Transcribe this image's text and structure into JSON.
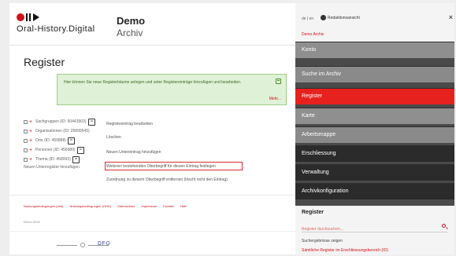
{
  "brand": {
    "name": "Oral-History.Digital"
  },
  "header": {
    "title": "Demo",
    "subtitle": "Archiv"
  },
  "page": {
    "title": "Register"
  },
  "info_box": {
    "text": "Hier können Sie neue Registerbäume anlegen und unter Registereinträge hinzufügen und bearbeiten.",
    "more": "Mehr..."
  },
  "tree": {
    "items": [
      {
        "label": "Sachgruppen (ID: 60443903)"
      },
      {
        "label": "Organisationen (ID: 25899545)"
      },
      {
        "label": "Orte (ID: 459888)"
      },
      {
        "label": "Personen (ID: 456989)"
      },
      {
        "label": "Thema (ID: 458993)"
      }
    ],
    "new_root": "Neuen Unterregister hinzufügen"
  },
  "context_menu": {
    "items": [
      "Registereintrag bearbeiten",
      "Löschen",
      "Neuen Untereintrag hinzufügen",
      "Weiteren bestehenden Oberbegriff für diesen Eintrag festlegen",
      "Zuordnung zu diesem Oberbegriff entfernen (löscht nicht den Eintrag)"
    ]
  },
  "footer": {
    "links": [
      "Nutzungsbedingungen (ohd)",
      "Nutzungsbedingungen (OHD)",
      "Datenschutz",
      "Impressum",
      "Kontakt",
      "Hilfe"
    ],
    "version": "Demo 2025"
  },
  "panel": {
    "lang": "de | en",
    "toggle_label": "Redaktionsansicht",
    "subtitle": "Demo Archiv",
    "nav": [
      {
        "label": "Konto",
        "state": "normal"
      },
      {
        "label": "Suche im Archiv",
        "state": "normal"
      },
      {
        "label": "Register",
        "state": "active"
      },
      {
        "label": "Karte",
        "state": "normal"
      },
      {
        "label": "Arbeitsmappe",
        "state": "normal"
      },
      {
        "label": "Erschliessung",
        "state": "dark"
      },
      {
        "label": "Verwaltung",
        "state": "dark"
      },
      {
        "label": "Archivkonfiguration",
        "state": "dark"
      }
    ],
    "register": {
      "title": "Register",
      "placeholder": "Register durchsuchen...",
      "hint": "Suchergebnisse zeigen",
      "link": "Sämtliche Register im Erschliessungsbereich (ID)"
    }
  },
  "colors": {
    "accent": "#e6211e",
    "brand_red": "#d01217",
    "panel_dark": "#2b2b2b",
    "info_bg": "#dff1d6"
  }
}
